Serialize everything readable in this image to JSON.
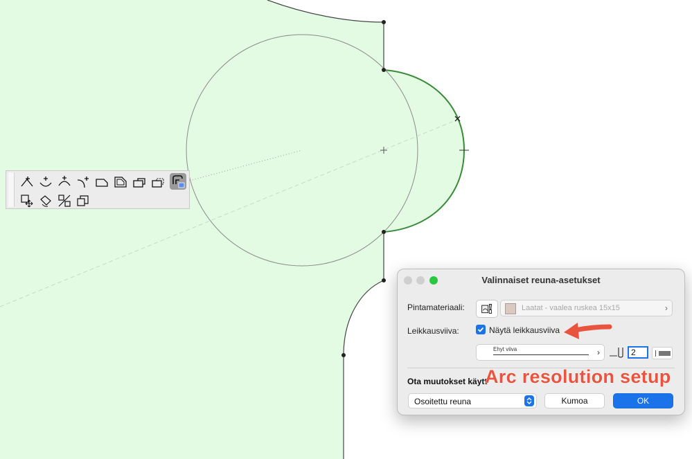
{
  "palette": {
    "tools": [
      {
        "icon": "insert-vertex-icon"
      },
      {
        "icon": "curve-edge-icon"
      },
      {
        "icon": "arc-edge-icon"
      },
      {
        "icon": "tangent-edge-icon"
      },
      {
        "icon": "offset-edge-icon"
      },
      {
        "icon": "offset-all-edges-icon"
      },
      {
        "icon": "add-to-polygon-icon"
      },
      {
        "icon": "subtract-from-polygon-icon"
      },
      {
        "icon": "custom-edge-settings-icon",
        "active": true
      },
      {
        "icon": "drag-icon"
      },
      {
        "icon": "rotate-icon"
      },
      {
        "icon": "mirror-icon"
      },
      {
        "icon": "multiply-icon"
      }
    ]
  },
  "dialog": {
    "title": "Valinnaiset reuna-asetukset",
    "material_label": "Pintamateriaali:",
    "material_value": "Laatat - vaalea ruskea 15x15",
    "cutline_label": "Leikkausviiva:",
    "show_cutline_label": "Näytä leikkausviiva",
    "show_cutline_checked": true,
    "line_type": "Ehyt viiva",
    "pen_value": "2",
    "apply_label": "Ota muutokset käytt",
    "apply_option": "Osoitettu reuna",
    "cancel_label": "Kumoa",
    "ok_label": "OK"
  },
  "annotation": {
    "text": "Arc resolution setup",
    "color": "#e9543f"
  },
  "colors": {
    "fill": "#e3fbe3",
    "selected_edge": "#3a8a3a",
    "accent": "#1a73e8"
  }
}
